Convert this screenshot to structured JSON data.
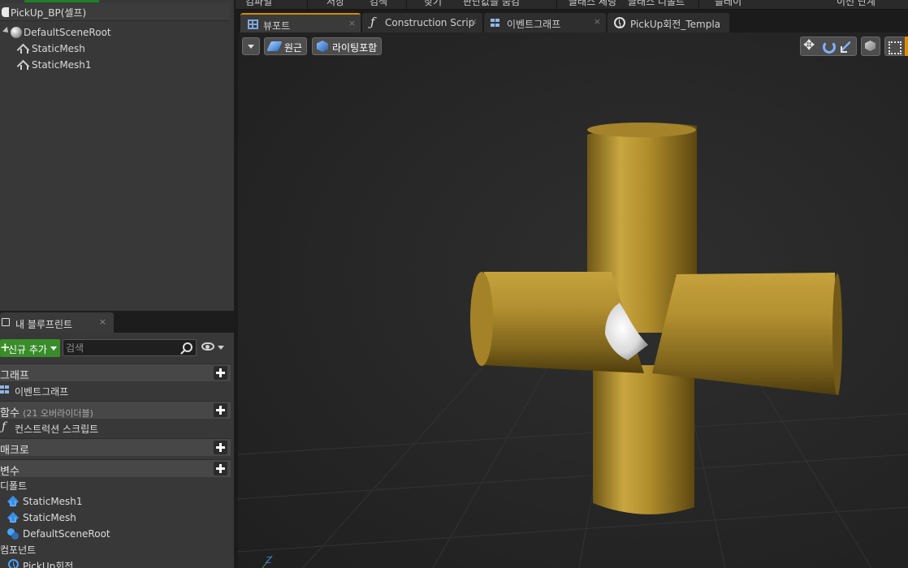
{
  "menu": {
    "items": [
      "컴파일",
      "저장",
      "검색",
      "찾기",
      "판단값을 숨김",
      "클래스 세팅",
      "클래스 디폴트",
      "플레이",
      "이전 단계"
    ]
  },
  "components": {
    "self_label": "PickUp_BP(셀프)",
    "tree": [
      {
        "label": "DefaultSceneRoot",
        "icon": "scene-root-icon"
      },
      {
        "label": "StaticMesh",
        "icon": "static-mesh-icon"
      },
      {
        "label": "StaticMesh1",
        "icon": "static-mesh-icon"
      }
    ]
  },
  "my_blueprint": {
    "tab_label": "내 블루프린트",
    "tab_close": "×",
    "add_new": "신규 추가",
    "search_placeholder": "검색",
    "categories": {
      "graphs": "그래프",
      "functions": "함수",
      "functions_sub": "(21 오버라이더블)",
      "macros": "매크로",
      "variables": "변수",
      "defaults": "디폴트",
      "components": "컴포넌트"
    },
    "graph_items": [
      "이벤트그래프"
    ],
    "function_items": [
      "컨스트럭션 스크립트"
    ],
    "default_vars": [
      "StaticMesh1",
      "StaticMesh",
      "DefaultSceneRoot"
    ],
    "component_vars": [
      "PickUp회전"
    ]
  },
  "doc_tabs": [
    {
      "label": "뷰포트",
      "icon": "viewport-icon",
      "close": "×"
    },
    {
      "label": "Construction Scrip",
      "icon": "function-icon",
      "close": "×"
    },
    {
      "label": "이벤트그래프",
      "icon": "event-graph-icon",
      "close": "×"
    },
    {
      "label": "PickUp회전_Templa",
      "icon": "timeline-icon",
      "close": ""
    }
  ],
  "viewport": {
    "perspective_label": "원근",
    "lighting_label": "라이팅포함",
    "axis_label": "Z"
  },
  "colors": {
    "accent_orange": "#d68a00",
    "add_green": "#3a8c2a",
    "mesh_gold": "#b8942e"
  }
}
